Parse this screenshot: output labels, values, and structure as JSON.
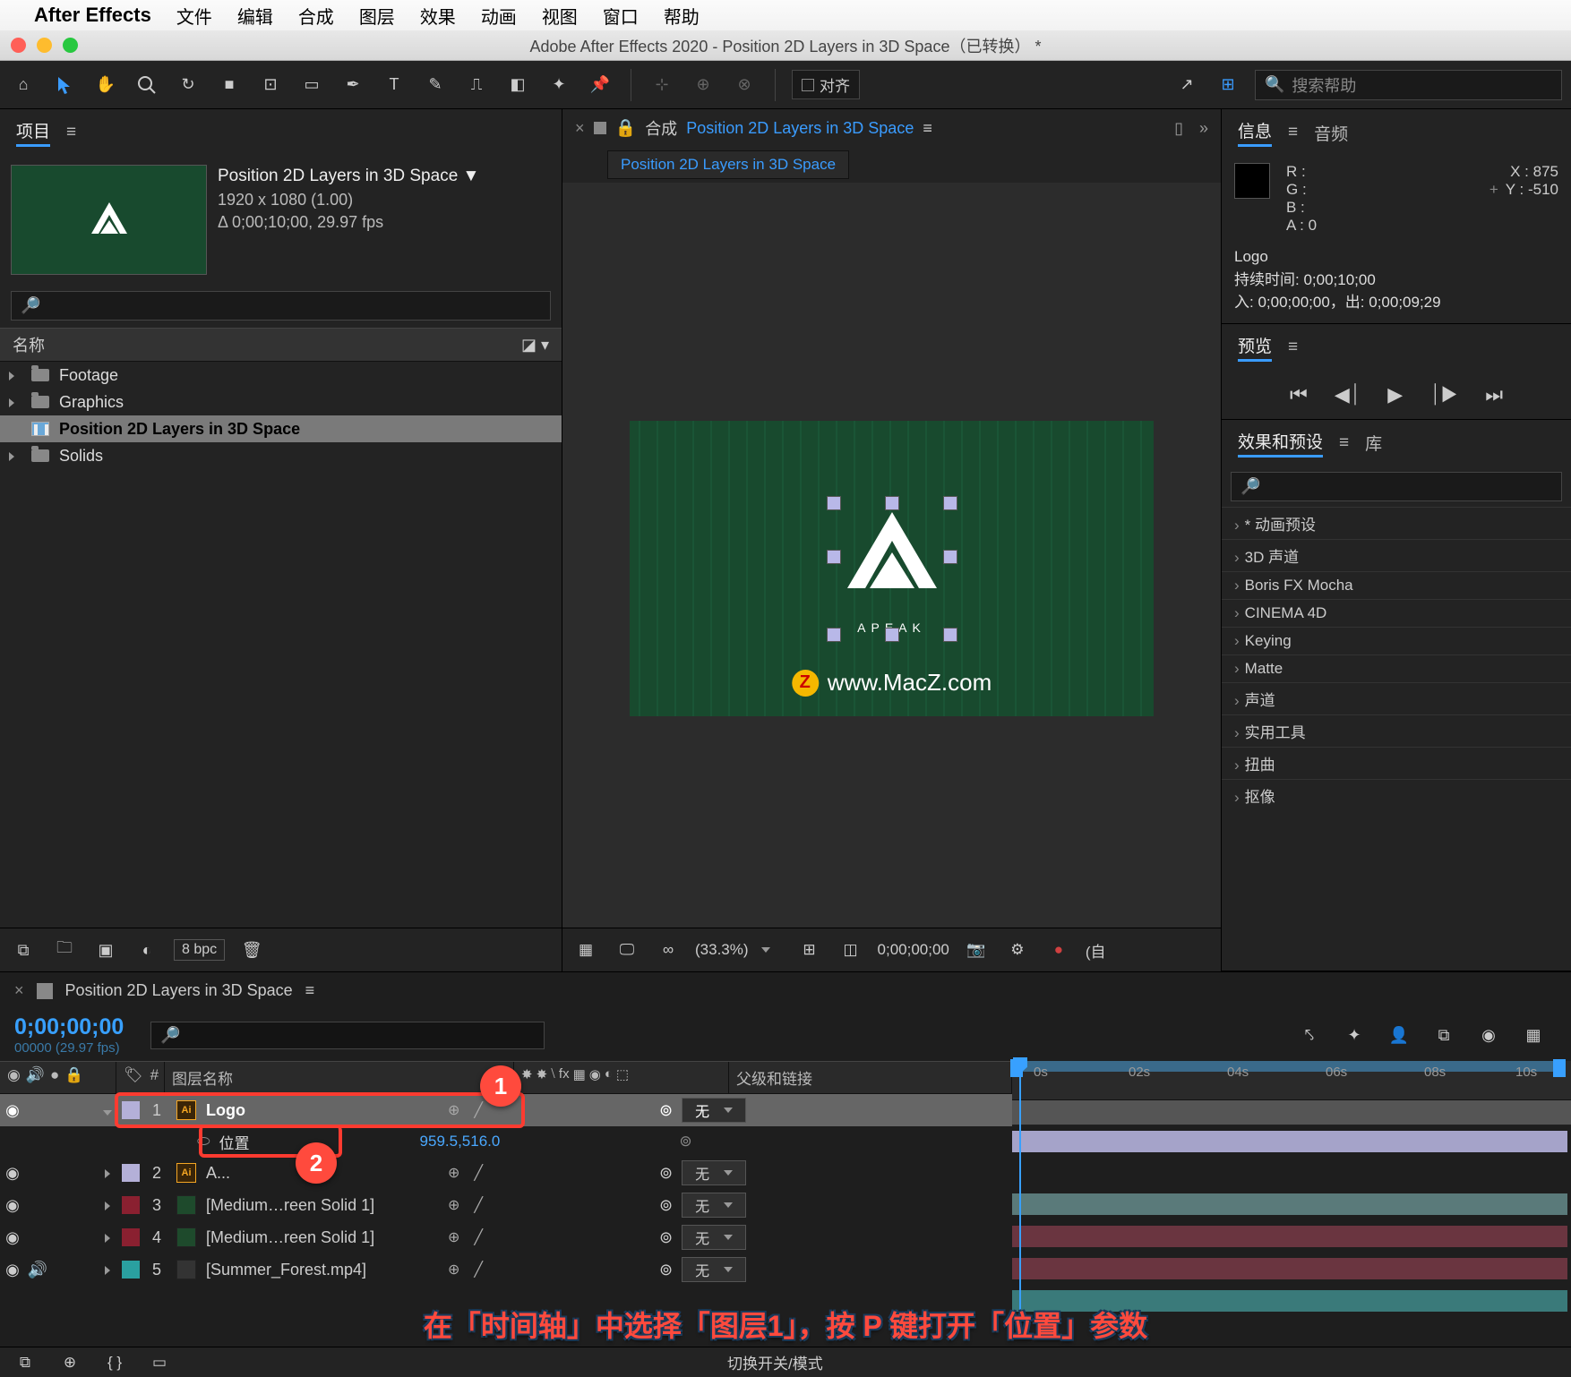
{
  "menubar": {
    "app": "After Effects",
    "items": [
      "文件",
      "编辑",
      "合成",
      "图层",
      "效果",
      "动画",
      "视图",
      "窗口",
      "帮助"
    ]
  },
  "titlebar": "Adobe After Effects 2020 - Position 2D Layers in 3D Space（已转换） *",
  "toolbar": {
    "align": "对齐",
    "search_placeholder": "搜索帮助"
  },
  "project": {
    "tab": "项目",
    "title": "Position 2D Layers in 3D Space ▼",
    "res": "1920 x 1080 (1.00)",
    "dur": "Δ 0;00;10;00, 29.97 fps",
    "col_name": "名称",
    "items": [
      {
        "type": "folder",
        "name": "Footage"
      },
      {
        "type": "folder",
        "name": "Graphics"
      },
      {
        "type": "comp",
        "name": "Position 2D Layers in 3D Space",
        "selected": true
      },
      {
        "type": "folder",
        "name": "Solids"
      }
    ],
    "bpc": "8 bpc"
  },
  "comp": {
    "label": "合成",
    "name": "Position 2D Layers in 3D Space",
    "tab": "Position 2D Layers in 3D Space",
    "logo_text": "APEAK",
    "watermark": "www.MacZ.com",
    "zoom": "(33.3%)",
    "time": "0;00;00;00",
    "res_label": "(自"
  },
  "info": {
    "tab1": "信息",
    "tab2": "音频",
    "r": "R :",
    "g": "G :",
    "b": "B :",
    "a": "A :  0",
    "x": "X : 875",
    "y": "Y : -510",
    "layer": "Logo",
    "dur": "持续时间: 0;00;10;00",
    "inout": "入: 0;00;00;00，出: 0;00;09;29"
  },
  "preview": {
    "tab": "预览"
  },
  "effects": {
    "tab1": "效果和预设",
    "tab2": "库",
    "items": [
      "* 动画预设",
      "3D 声道",
      "Boris FX Mocha",
      "CINEMA 4D",
      "Keying",
      "Matte",
      "声道",
      "实用工具",
      "扭曲",
      "抠像"
    ]
  },
  "timeline": {
    "tab": "Position 2D Layers in 3D Space",
    "time": "0;00;00;00",
    "frames": "00000 (29.97 fps)",
    "col_layer": "图层名称",
    "col_parent": "父级和链接",
    "position_label": "位置",
    "position_value": "959.5,516.0",
    "parent_none": "无",
    "layers": [
      {
        "n": "1",
        "name": "Logo",
        "color": "#b4b0d8",
        "ic": "ai",
        "sel": true,
        "twirl": "▾",
        "bar": "#a5a3c9"
      },
      {
        "n": "2",
        "name": "A...",
        "color": "#b4b0d8",
        "ic": "ai",
        "bar": "#5a7a7a"
      },
      {
        "n": "3",
        "name": "[Medium…reen Solid 1]",
        "color": "#8a2030",
        "ic": "solid",
        "solid": "#1e4a2c",
        "bar": "#6a3540"
      },
      {
        "n": "4",
        "name": "[Medium…reen Solid 1]",
        "color": "#8a2030",
        "ic": "solid",
        "solid": "#1e4a2c",
        "bar": "#6a3540"
      },
      {
        "n": "5",
        "name": "[Summer_Forest.mp4]",
        "color": "#2aa0a0",
        "ic": "solid",
        "solid": "#333",
        "bar": "#3a7a7a"
      }
    ],
    "ticks": [
      "0s",
      "02s",
      "04s",
      "06s",
      "08s",
      "10s"
    ],
    "mode": "切换开关/模式"
  },
  "annotations": {
    "b1": "1",
    "b2": "2",
    "caption": "在「时间轴」中选择「图层1」，按 P 键打开「位置」参数"
  }
}
